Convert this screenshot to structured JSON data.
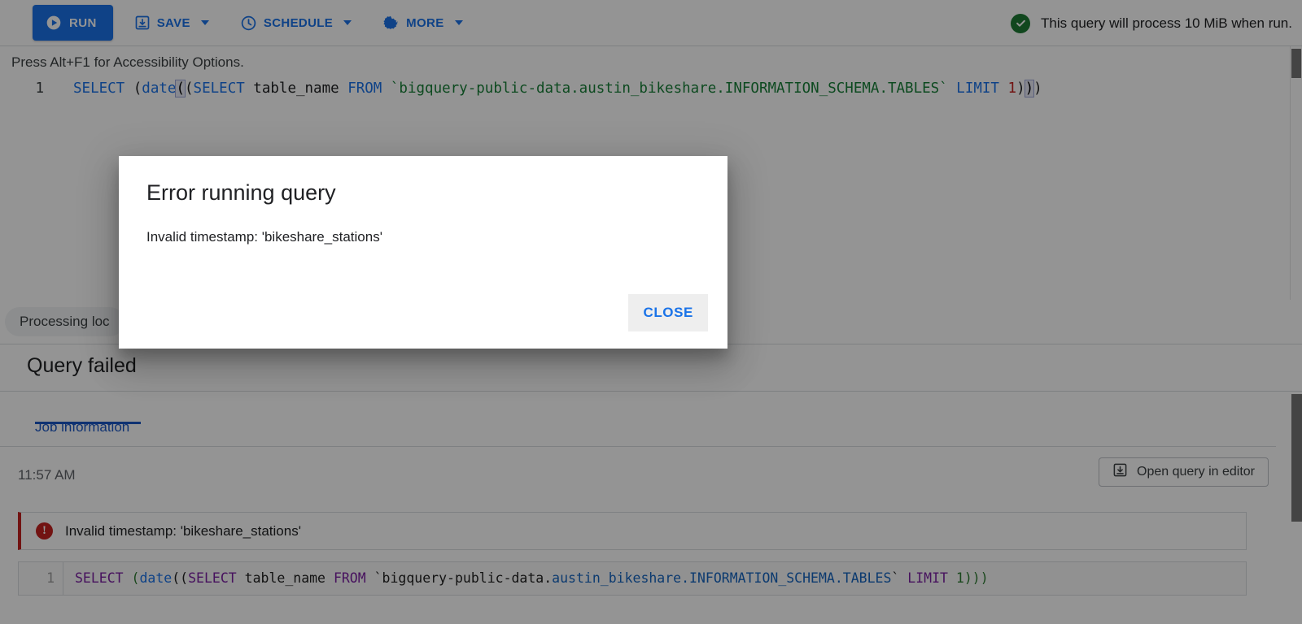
{
  "toolbar": {
    "run_label": "RUN",
    "run_icon": "play-circle-icon",
    "save_label": "SAVE",
    "save_icon": "save-disk-icon",
    "schedule_label": "SCHEDULE",
    "schedule_icon": "clock-icon",
    "more_label": "MORE",
    "more_icon": "gear-icon",
    "status_text": "This query will process 10 MiB when run.",
    "status_icon": "check-circle-icon",
    "accent_color": "#1a73e8",
    "status_icon_color": "#1e7b34"
  },
  "editor": {
    "accessibility_hint": "Press Alt+F1 for Accessibility Options.",
    "line_number": "1",
    "tokens": [
      {
        "t": "SELECT",
        "c": "kw"
      },
      {
        "t": " (",
        "c": "plain"
      },
      {
        "t": "date",
        "c": "fn"
      },
      {
        "t": "(",
        "c": "paren-hl"
      },
      {
        "t": "(",
        "c": "plain"
      },
      {
        "t": "SELECT",
        "c": "kw"
      },
      {
        "t": " table_name ",
        "c": "plain"
      },
      {
        "t": "FROM",
        "c": "kw"
      },
      {
        "t": " `bigquery-public-data.austin_bikeshare.INFORMATION_SCHEMA.TABLES`",
        "c": "str"
      },
      {
        "t": " ",
        "c": "plain"
      },
      {
        "t": "LIMIT",
        "c": "kw"
      },
      {
        "t": " ",
        "c": "plain"
      },
      {
        "t": "1",
        "c": "num"
      },
      {
        "t": ")",
        "c": "plain"
      },
      {
        "t": ")",
        "c": "paren-hl"
      },
      {
        "t": ")",
        "c": "plain"
      }
    ],
    "full_text": "SELECT (date((SELECT table_name FROM `bigquery-public-data.austin_bikeshare.INFORMATION_SCHEMA.TABLES` LIMIT 1)))"
  },
  "chip": {
    "label": "Processing loc",
    "full_label_hint": "Processing loc"
  },
  "results": {
    "heading": "Query failed",
    "tab_label": "Job information",
    "timestamp": "11:57 AM",
    "open_in_editor_label": "Open query in editor",
    "open_in_editor_icon": "download-box-icon",
    "error_text": "Invalid timestamp: 'bikeshare_stations'",
    "error_icon": "error-exclamation-icon",
    "error_color": "#c5221f",
    "sql_line_number": "1",
    "sql_tokens": [
      {
        "t": "SELECT",
        "c": "p-kw"
      },
      {
        "t": " (",
        "c": "p-paren"
      },
      {
        "t": "date",
        "c": "p-fn"
      },
      {
        "t": "((",
        "c": "p-plain"
      },
      {
        "t": "SELECT",
        "c": "p-kw"
      },
      {
        "t": " table_name ",
        "c": "p-plain"
      },
      {
        "t": "FROM",
        "c": "p-kw"
      },
      {
        "t": " `bigquery-public-data.",
        "c": "p-plain"
      },
      {
        "t": "austin_bikeshare.INFORMATION_SCHEMA.TABLES",
        "c": "p-id"
      },
      {
        "t": "` ",
        "c": "p-plain"
      },
      {
        "t": "LIMIT",
        "c": "p-kw"
      },
      {
        "t": " ",
        "c": "p-plain"
      },
      {
        "t": "1",
        "c": "p-num"
      },
      {
        "t": ")))",
        "c": "p-paren"
      }
    ],
    "sql_full_text": "SELECT (date((SELECT table_name FROM `bigquery-public-data.austin_bikeshare.INFORMATION_SCHEMA.TABLES` LIMIT 1)))"
  },
  "dialog": {
    "title": "Error running query",
    "message": "Invalid timestamp: 'bikeshare_stations'",
    "close_label": "CLOSE"
  }
}
